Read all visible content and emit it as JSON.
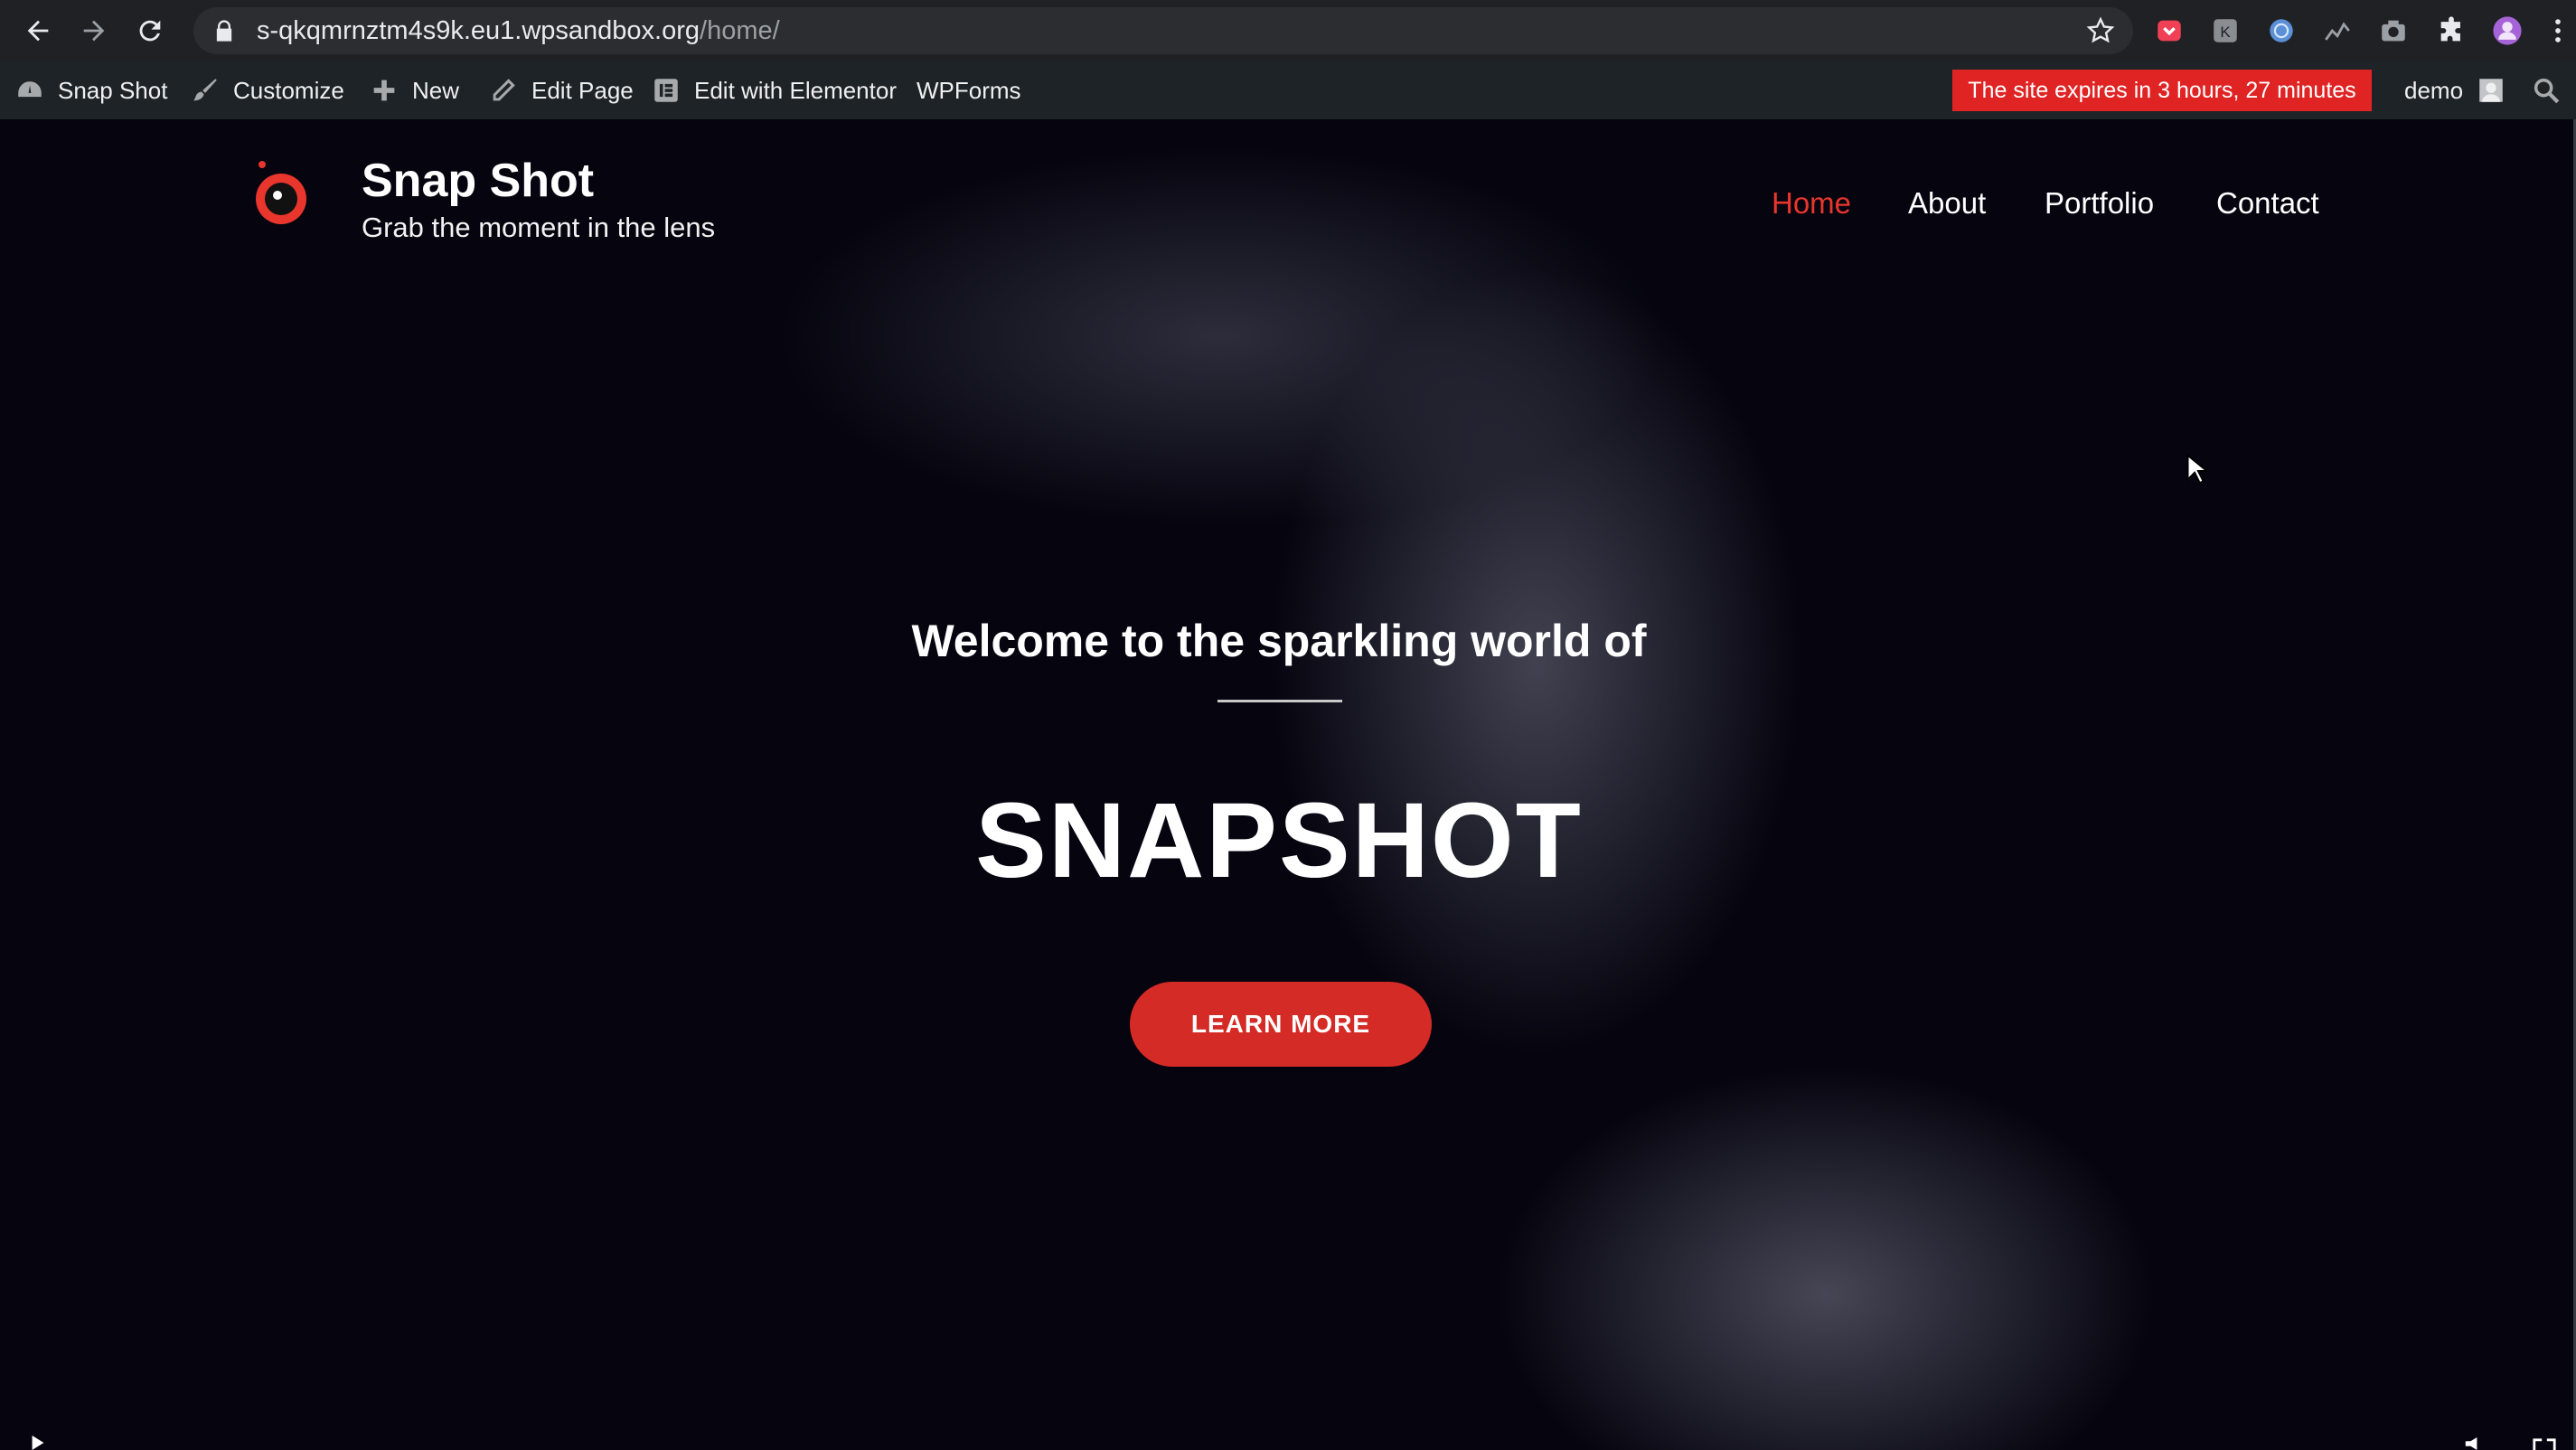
{
  "browser": {
    "url_host": "s-qkqmrnztm4s9k.eu1.wpsandbox.org",
    "url_path": "/home/",
    "nav_icons": [
      "back-arrow-icon",
      "forward-arrow-icon",
      "reload-icon"
    ],
    "extensions": [
      "pocket-icon",
      "extension-k-icon",
      "globe-extension-icon",
      "analytics-icon",
      "camera-icon",
      "puzzle-icon",
      "profile-avatar-icon"
    ]
  },
  "admin_bar": {
    "site_name": "Snap Shot",
    "customize": "Customize",
    "new": "New",
    "edit_page": "Edit Page",
    "edit_elementor": "Edit with Elementor",
    "wpforms": "WPForms",
    "expires_label": "The site expires in  3 hours, 27 minutes",
    "user": "demo"
  },
  "site": {
    "title": "Snap Shot",
    "tagline": "Grab the moment in the lens",
    "menu": [
      {
        "label": "Home",
        "active": true
      },
      {
        "label": "About",
        "active": false
      },
      {
        "label": "Portfolio",
        "active": false
      },
      {
        "label": "Contact",
        "active": false
      }
    ]
  },
  "hero": {
    "welcome": "Welcome to the sparkling world of",
    "headline": "SNAPSHOT",
    "button": "LEARN MORE"
  },
  "colors": {
    "accent": "#e8362d",
    "button": "#d42b26",
    "expires_bg": "#e02424",
    "admin_bar": "#1d2327",
    "chrome": "#202124"
  }
}
